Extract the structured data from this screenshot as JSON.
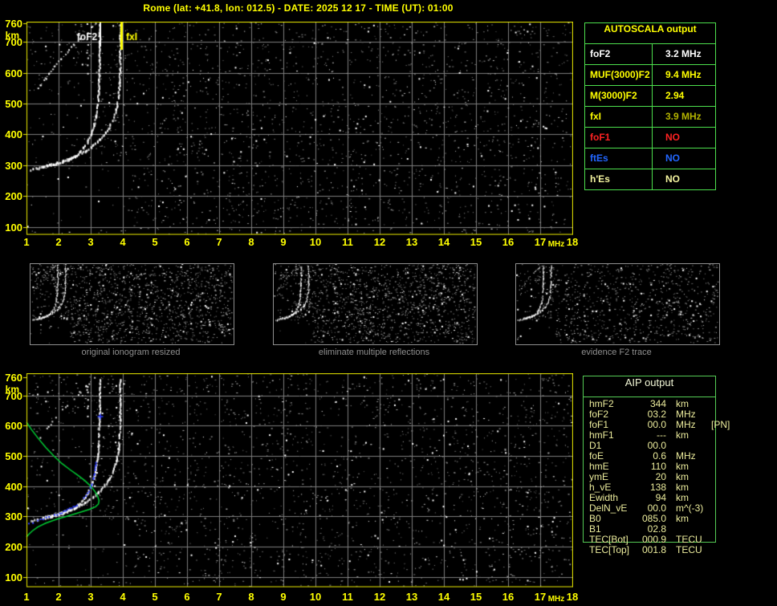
{
  "header": {
    "title": "Rome (lat: +41.8, lon: 012.5) - DATE: 2025 12 17 - TIME (UT): 01:00"
  },
  "colors": {
    "accent_yellow": "#ffff00",
    "frame": "#e9e900",
    "grid": "#7d7d7d",
    "trace": "#ffffff",
    "fxi_marker": "#ffff00",
    "profile_green": "#00cd33",
    "restored_blue": "#2b3cff",
    "autoscala_border": "#4de04d",
    "aip_border": "#55cc55",
    "aip_text": "#ecec9c",
    "caption_gray": "#8f8f8f"
  },
  "ionogram_axes": {
    "x_ticks": [
      "1",
      "2",
      "3",
      "4",
      "5",
      "6",
      "7",
      "8",
      "9",
      "10",
      "11",
      "12",
      "13",
      "14",
      "15",
      "16",
      "17",
      "18"
    ],
    "x_unit": "MHz",
    "y_ticks": [
      "760",
      "700",
      "600",
      "500",
      "400",
      "300",
      "200",
      "100"
    ],
    "y_unit": "km"
  },
  "top_plot": {
    "markers": {
      "fof2_label": "foF2",
      "fof2_freq": 3.28,
      "fxi_label": "fxI",
      "fxi_freq": 3.95
    }
  },
  "traces": {
    "o_mode": [
      [
        1.12,
        288
      ],
      [
        1.3,
        292
      ],
      [
        1.5,
        297
      ],
      [
        1.7,
        302
      ],
      [
        1.9,
        307
      ],
      [
        2.1,
        313
      ],
      [
        2.3,
        321
      ],
      [
        2.5,
        332
      ],
      [
        2.65,
        346
      ],
      [
        2.78,
        362
      ],
      [
        2.9,
        382
      ],
      [
        3.0,
        404
      ],
      [
        3.08,
        430
      ],
      [
        3.15,
        462
      ],
      [
        3.2,
        500
      ],
      [
        3.23,
        545
      ],
      [
        3.25,
        595
      ],
      [
        3.26,
        645
      ],
      [
        3.26,
        700
      ],
      [
        3.26,
        756
      ]
    ],
    "x_mode": [
      [
        1.55,
        300
      ],
      [
        1.8,
        307
      ],
      [
        2.05,
        314
      ],
      [
        2.3,
        323
      ],
      [
        2.55,
        334
      ],
      [
        2.8,
        348
      ],
      [
        3.0,
        362
      ],
      [
        3.2,
        380
      ],
      [
        3.4,
        402
      ],
      [
        3.55,
        425
      ],
      [
        3.68,
        452
      ],
      [
        3.78,
        485
      ],
      [
        3.85,
        525
      ],
      [
        3.88,
        570
      ],
      [
        3.9,
        620
      ],
      [
        3.9,
        672
      ],
      [
        3.9,
        725
      ],
      [
        3.9,
        756
      ]
    ],
    "oblique": [
      [
        1.52,
        578
      ],
      [
        1.68,
        600
      ],
      [
        1.85,
        622
      ],
      [
        2.05,
        646
      ],
      [
        2.25,
        670
      ],
      [
        2.45,
        692
      ],
      [
        2.65,
        713
      ],
      [
        2.85,
        733
      ],
      [
        3.02,
        750
      ],
      [
        3.12,
        760
      ]
    ],
    "oblique_fragment": [
      [
        1.3,
        545
      ],
      [
        1.42,
        562
      ],
      [
        1.52,
        576
      ]
    ],
    "extra_vertical": [
      [
        2.88,
        600
      ],
      [
        2.88,
        660
      ],
      [
        2.88,
        720
      ],
      [
        2.88,
        758
      ]
    ]
  },
  "bottom_plot": {
    "profile_green": [
      [
        1.0,
        612
      ],
      [
        1.15,
        588
      ],
      [
        1.35,
        560
      ],
      [
        1.6,
        528
      ],
      [
        1.85,
        500
      ],
      [
        2.1,
        475
      ],
      [
        2.35,
        455
      ],
      [
        2.6,
        436
      ],
      [
        2.82,
        418
      ],
      [
        3.0,
        400
      ],
      [
        3.13,
        383
      ],
      [
        3.22,
        366
      ],
      [
        3.26,
        352
      ],
      [
        3.24,
        341
      ],
      [
        3.15,
        332
      ],
      [
        2.95,
        323
      ],
      [
        2.65,
        313
      ],
      [
        2.3,
        302
      ],
      [
        1.95,
        291
      ],
      [
        1.6,
        278
      ],
      [
        1.35,
        265
      ],
      [
        1.18,
        252
      ],
      [
        1.07,
        241
      ],
      [
        1.0,
        232
      ]
    ],
    "restored_blue": [
      [
        1.05,
        277
      ],
      [
        1.18,
        283
      ],
      [
        1.33,
        289
      ],
      [
        1.5,
        295
      ],
      [
        1.68,
        301
      ],
      [
        1.85,
        307
      ],
      [
        2.02,
        313
      ],
      [
        2.2,
        321
      ],
      [
        2.38,
        330
      ],
      [
        2.55,
        341
      ],
      [
        2.7,
        354
      ],
      [
        2.83,
        369
      ],
      [
        2.93,
        386
      ],
      [
        3.0,
        404
      ],
      [
        3.06,
        424
      ],
      [
        3.1,
        445
      ],
      [
        3.13,
        467
      ],
      [
        3.15,
        488
      ]
    ],
    "blue_cross": [
      3.3,
      630
    ]
  },
  "thumbnails": [
    {
      "caption": "original ionogram resized"
    },
    {
      "caption": "eliminate multiple reflections"
    },
    {
      "caption": "evidence F2 trace"
    }
  ],
  "autoscala_table": {
    "title": "AUTOSCALA output",
    "rows": [
      {
        "label": "foF2",
        "value": "3.2 MHz",
        "label_color": "#ffffff",
        "value_color": "#ffffff"
      },
      {
        "label": "MUF(3000)F2",
        "value": "9.4 MHz",
        "label_color": "#ffff00",
        "value_color": "#ffff00"
      },
      {
        "label": "M(3000)F2",
        "value": "2.94",
        "label_color": "#ffff00",
        "value_color": "#ffff00"
      },
      {
        "label": "fxI",
        "value": "3.9 MHz",
        "label_color": "#ffff00",
        "value_color": "#b2b200"
      },
      {
        "label": "foF1",
        "value": "NO",
        "label_color": "#ff2222",
        "value_color": "#ff2222"
      },
      {
        "label": "ftEs",
        "value": "NO",
        "label_color": "#2266ff",
        "value_color": "#2266ff"
      },
      {
        "label": "h'Es",
        "value": "NO",
        "label_color": "#f5f5a0",
        "value_color": "#f5f5a0"
      }
    ]
  },
  "aip_table": {
    "title": "AIP output",
    "rows": [
      {
        "label": "hmF2",
        "value": "344",
        "unit": "km",
        "note": ""
      },
      {
        "label": "foF2",
        "value": "03.2",
        "unit": "MHz",
        "note": ""
      },
      {
        "label": "foF1",
        "value": "00.0",
        "unit": "MHz",
        "note": "[PN]"
      },
      {
        "label": "hmF1",
        "value": "---",
        "unit": "km",
        "note": ""
      },
      {
        "label": "D1",
        "value": "00.0",
        "unit": "",
        "note": ""
      },
      {
        "label": "foE",
        "value": "0.6",
        "unit": "MHz",
        "note": ""
      },
      {
        "label": "hmE",
        "value": "110",
        "unit": "km",
        "note": ""
      },
      {
        "label": "ymE",
        "value": "20",
        "unit": "km",
        "note": ""
      },
      {
        "label": "h_vE",
        "value": "138",
        "unit": "km",
        "note": ""
      },
      {
        "label": "Ewidth",
        "value": "94",
        "unit": "km",
        "note": ""
      },
      {
        "label": "DelN_vE",
        "value": "00.0",
        "unit": "m^(-3)",
        "note": ""
      },
      {
        "label": "B0",
        "value": "085.0",
        "unit": "km",
        "note": ""
      },
      {
        "label": "B1",
        "value": "02.8",
        "unit": "",
        "note": ""
      },
      {
        "label": "TEC[Bot]",
        "value": "000.9",
        "unit": "TECU",
        "note": ""
      },
      {
        "label": "TEC[Top]",
        "value": "001.8",
        "unit": "TECU",
        "note": ""
      }
    ]
  }
}
